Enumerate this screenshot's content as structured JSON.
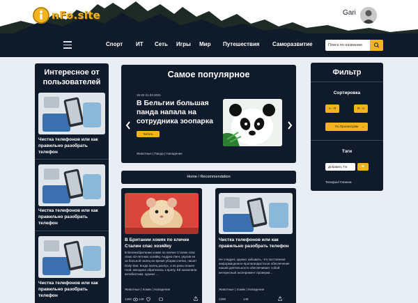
{
  "header": {
    "logo_text": "nFo.site",
    "user_name": "Gari"
  },
  "nav": {
    "items": [
      "Спорт",
      "ИТ",
      "Сеть",
      "Игры",
      "Мир",
      "Путешествия",
      "Саморазвитие"
    ],
    "search_placeholder": "Поиск по названию"
  },
  "left_column": {
    "title": "Интересное от пользователей",
    "items": [
      {
        "title": "Чистка телефонов или как правильно разобрать телефон"
      },
      {
        "title": "Чистка телефонов или как правильно разобрать телефон"
      },
      {
        "title": "Чистка телефонов или как правильно разобрать телефон"
      }
    ]
  },
  "popular": {
    "title": "Самое популярное",
    "date": "15:40 21.03.2021",
    "headline": "В Бельгии большая панда напала на сотрудника зоопарка",
    "read_label": "Читать",
    "tags": "Животные | Панда | Нападение"
  },
  "breadcrumb": "Home / Recommendation",
  "cards": [
    {
      "title": "В Британии хомяк по кличке Сталин спас хозяйку",
      "desc": "В Великобритании хомяк по кличке Сталин спас свою 43-летнюю хозяйку Андреа Линг, укусив ее за больной палец во время уборки клетки, пишет Daily Star. Когда палец распух, а из раны пошел гной, женщина обратилась к врачу. Ей назначили антибиотики, однако ...",
      "tags": "Животные | Хомяк | Нападение",
      "views": "1290",
      "likes": "149"
    },
    {
      "title": "Чистка телефонов или как правильно разобрать телефон",
      "desc": "Не следует, однако забывать, что постоянное информационно-пропагандистское обеспечение нашей деятельности обеспечивает собой интересный эксперимент проверки...",
      "tags": "Животные | Хомяк | Нападение",
      "views": "1290",
      "likes": "149"
    }
  ],
  "filter": {
    "title": "Фильтр",
    "sort_label": "Сортировка",
    "sort_az": "А - Я",
    "sort_za": "Я - А",
    "sort_views": "По Просмотрам",
    "tags_label": "Тэги",
    "add_tag_label": "Добавить Тэг",
    "add_symbol": "+",
    "active_tags": "Телефон/ Гигиена"
  },
  "colors": {
    "accent": "#f1b41c",
    "panel": "#0f1a2a",
    "background": "#e9eef5"
  }
}
